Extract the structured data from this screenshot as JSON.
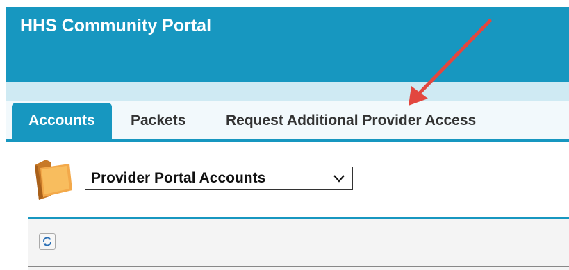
{
  "header": {
    "title": "HHS Community Portal"
  },
  "tabs": [
    {
      "label": "Accounts",
      "active": true
    },
    {
      "label": "Packets",
      "active": false
    },
    {
      "label": "Request Additional Provider Access",
      "active": false
    }
  ],
  "view": {
    "selected": "Provider Portal Accounts",
    "folder_icon": "folder-icon"
  },
  "toolbar": {
    "refresh_icon": "refresh-icon"
  },
  "colors": {
    "brand": "#1797c0",
    "annotation_arrow": "#e2473f"
  }
}
